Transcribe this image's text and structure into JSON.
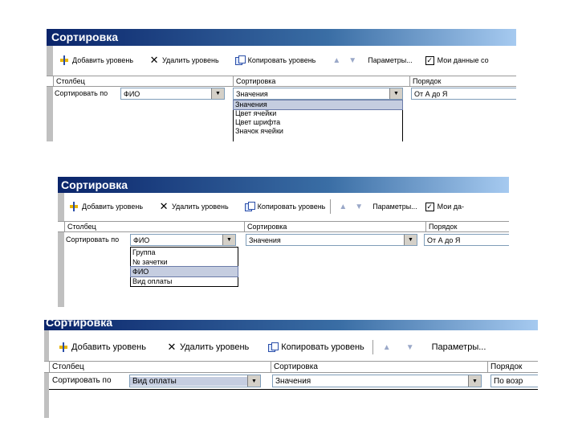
{
  "colors": {
    "title_gradient_start": "#0a246a",
    "title_gradient_end": "#a6caf0",
    "selection": "#c5cde0"
  },
  "dialog1": {
    "title": "Сортировка",
    "toolbar": {
      "add": "Добавить уровень",
      "delete": "Удалить уровень",
      "copy": "Копировать уровень",
      "params": "Параметры...",
      "my_data": "Мои данные со"
    },
    "headers": {
      "column": "Столбец",
      "sort": "Сортировка",
      "order": "Порядок"
    },
    "row": {
      "label": "Сортировать по",
      "column_value": "ФИО",
      "sort_value": "Значения",
      "order_value": "От А до Я"
    },
    "dropdown": [
      "Значения",
      "Цвет ячейки",
      "Цвет шрифта",
      "Значок ячейки"
    ]
  },
  "dialog2": {
    "title": "Сортировка",
    "toolbar": {
      "add": "Добавить уровень",
      "delete": "Удалить уровень",
      "copy": "Копировать уровень",
      "params": "Параметры...",
      "my_data": "Мои да-"
    },
    "headers": {
      "column": "Столбец",
      "sort": "Сортировка",
      "order": "Порядок"
    },
    "row": {
      "label": "Сортировать по",
      "column_value": "ФИО",
      "sort_value": "Значения",
      "order_value": "От А до Я"
    },
    "dropdown": [
      "Группа",
      "№ зачетки",
      "ФИО",
      "Вид оплаты"
    ]
  },
  "dialog3": {
    "title": "Сортировка",
    "toolbar": {
      "add": "Добавить уровень",
      "delete": "Удалить уровень",
      "copy": "Копировать уровень",
      "params": "Параметры..."
    },
    "headers": {
      "column": "Столбец",
      "sort": "Сортировка",
      "order": "Порядок"
    },
    "row": {
      "label": "Сортировать по",
      "column_value": "Вид оплаты",
      "sort_value": "Значения",
      "order_value": "По возр"
    }
  }
}
